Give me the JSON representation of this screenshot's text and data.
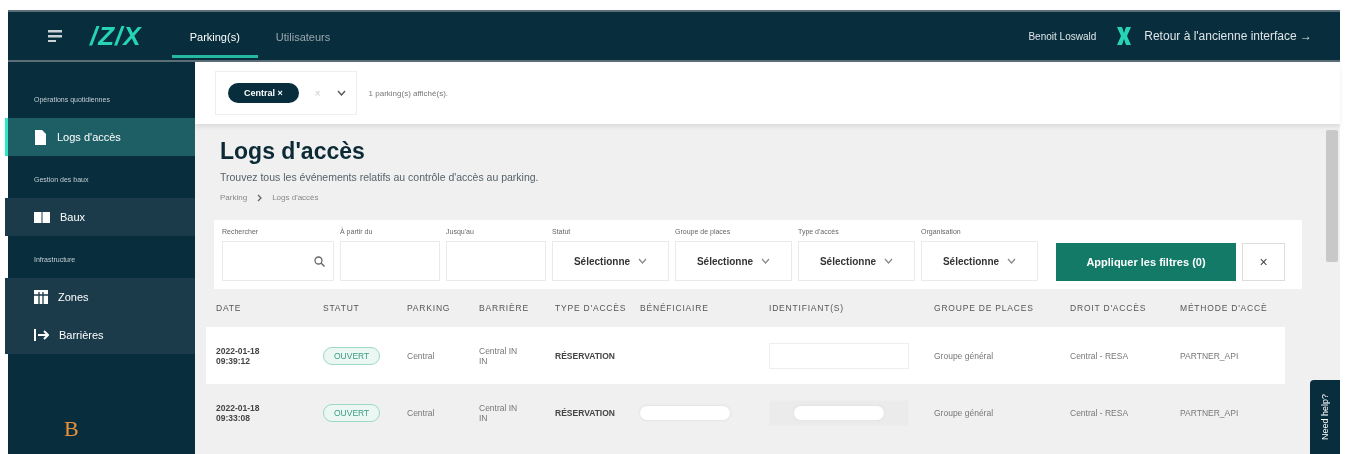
{
  "header": {
    "logo": "/Z/X",
    "tabs": [
      {
        "label": "Parking(s)",
        "selected": true
      },
      {
        "label": "Utilisateurs",
        "selected": false
      }
    ],
    "user": "Benoit Loswald",
    "back_link": "Retour à l'ancienne interface →"
  },
  "sidebar": {
    "sections": [
      {
        "title": "Opérations quotidiennes",
        "items": [
          {
            "label": "Logs d'accès",
            "kind": "document",
            "selected": true
          }
        ]
      },
      {
        "title": "Gestion des baux",
        "items": [
          {
            "label": "Baux",
            "kind": "book",
            "selected": false
          }
        ]
      },
      {
        "title": "Infrastructure",
        "items": [
          {
            "label": "Zones",
            "kind": "grid",
            "selected": false
          },
          {
            "label": "Barrières",
            "kind": "exit",
            "selected": false
          }
        ]
      }
    ],
    "footer_mark": "B"
  },
  "parking_bar": {
    "chips": [
      "Central ×"
    ],
    "clear": "×",
    "count": "1 parking(s) affiché(s)."
  },
  "page": {
    "title": "Logs d'accès",
    "subtitle": "Trouvez tous les événements relatifs au contrôle d'accès au parking.",
    "breadcrumb": [
      "Parking",
      "Logs d'accès"
    ]
  },
  "filters": {
    "fields": [
      {
        "label": "Rechercher",
        "kind": "search"
      },
      {
        "label": "À partir du",
        "kind": "date"
      },
      {
        "label": "Jusqu'au",
        "kind": "date"
      },
      {
        "label": "Statut",
        "kind": "select",
        "value": "Sélectionne"
      },
      {
        "label": "Groupe de places",
        "kind": "select",
        "value": "Sélectionne"
      },
      {
        "label": "Type d'accès",
        "kind": "select",
        "value": "Sélectionne"
      },
      {
        "label": "Organisation",
        "kind": "select",
        "value": "Sélectionne"
      }
    ],
    "apply": "Appliquer les filtres (0)",
    "reset": "×"
  },
  "table": {
    "columns": [
      "DATE",
      "STATUT",
      "PARKING",
      "BARRIÈRE",
      "TYPE D'ACCÈS",
      "BÉNÉFICIAIRE",
      "IDENTIFIANT(S)",
      "GROUPE DE PLACES",
      "DROIT D'ACCÈS",
      "MÉTHODE D'ACCÈ"
    ],
    "rows": [
      {
        "date": "2022-01-18\n09:39:12",
        "status": {
          "label": "OUVERT",
          "kind": "open"
        },
        "parking": "Central",
        "barrier": "Central IN\nIN",
        "access_type": "RÉSERVATION",
        "beneficiary_redacted": false,
        "identifier_redacted": false,
        "group": "Groupe général",
        "right": "Central - RESA",
        "method": "PARTNER_API"
      },
      {
        "date": "2022-01-18\n09:33:08",
        "status": {
          "label": "OUVERT",
          "kind": "open"
        },
        "parking": "Central",
        "barrier": "Central IN\nIN",
        "access_type": "RÉSERVATION",
        "beneficiary_redacted": true,
        "identifier_redacted": true,
        "group": "Groupe général",
        "right": "Central - RESA",
        "method": "PARTNER_API"
      }
    ]
  },
  "help_tab": "Need help?"
}
